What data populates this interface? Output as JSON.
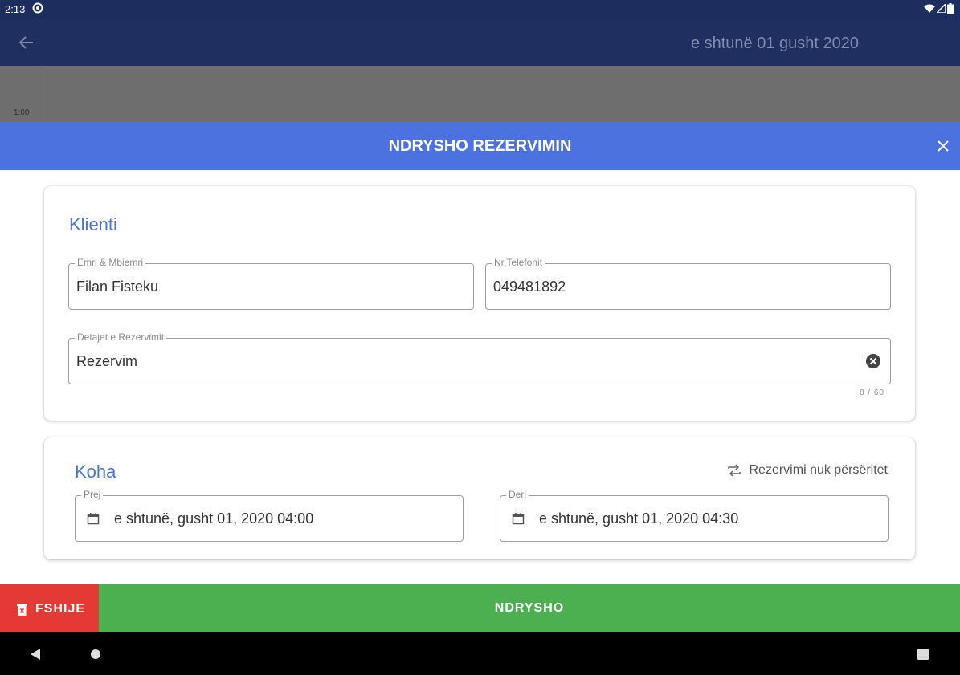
{
  "status_bar": {
    "time": "2:13"
  },
  "app_bar": {
    "date": "e shtunë 01 gusht 2020"
  },
  "calendar": {
    "hour_label": "1:00"
  },
  "dialog": {
    "title": "NDRYSHO REZERVIMIN"
  },
  "client_section": {
    "title": "Klienti",
    "name_field": {
      "label": "Emri & Mbiemri",
      "value": "Filan Fisteku"
    },
    "phone_field": {
      "label": "Nr.Telefonit",
      "value": "049481892"
    },
    "details_field": {
      "label": "Detajet e Rezervimit",
      "value": "Rezervim",
      "counter": "8 / 60"
    }
  },
  "time_section": {
    "title": "Koha",
    "repeat_label": "Rezervimi nuk përsëritet",
    "from_field": {
      "label": "Prej",
      "value": "e shtunë, gusht 01, 2020   04:00"
    },
    "to_field": {
      "label": "Deri",
      "value": "e shtunë, gusht 01, 2020   04:30"
    }
  },
  "actions": {
    "delete_label": "FSHIJE",
    "save_label": "NDRYSHO"
  },
  "colors": {
    "accent": "#4b72df",
    "app_bar": "#1f3060",
    "delete": "#e53935",
    "save": "#4caf50"
  },
  "icons": [
    "status-app-icon",
    "wifi-icon",
    "signal-icon",
    "battery-icon",
    "back-arrow-icon",
    "close-icon",
    "clear-icon",
    "calendar-icon",
    "repeat-icon",
    "trash-icon",
    "nav-back-icon",
    "nav-home-icon",
    "nav-recents-icon"
  ]
}
